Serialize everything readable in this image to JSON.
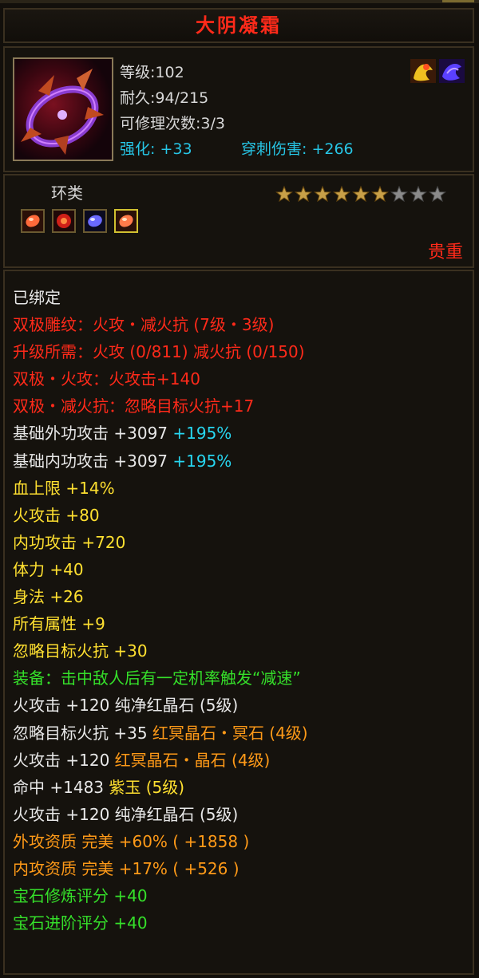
{
  "title": "大阴凝霜",
  "item": {
    "level": "等级:102",
    "durability": "耐久:94/215",
    "repairs": "可修理次数:3/3",
    "enhance": "强化: +33",
    "pierce": "穿刺伤害: +266"
  },
  "category": "环类",
  "stars": {
    "filled": 6,
    "total": 9
  },
  "rarity": "贵重",
  "colors": {
    "title": "#ff2a1a",
    "cyan": "#27d6f0",
    "green": "#35e02a",
    "orange": "#ff9a18",
    "yellow": "#ffe030",
    "red": "#ff2a1a",
    "white": "#e8e8e8"
  },
  "lines": [
    {
      "segs": [
        {
          "t": "已绑定",
          "c": "white"
        }
      ]
    },
    {
      "segs": [
        {
          "t": "双极雕纹：火攻・减火抗 (7级・3级)",
          "c": "red"
        }
      ]
    },
    {
      "segs": [
        {
          "t": "升级所需：火攻 (0/811)  减火抗 (0/150)",
          "c": "red"
        }
      ]
    },
    {
      "segs": [
        {
          "t": "双极・火攻：火攻击+140",
          "c": "red"
        }
      ]
    },
    {
      "segs": [
        {
          "t": "双极・减火抗：忽略目标火抗+17",
          "c": "red"
        }
      ]
    },
    {
      "segs": [
        {
          "t": "基础外功攻击 +3097 ",
          "c": "white"
        },
        {
          "t": "+195%",
          "c": "cyan"
        }
      ]
    },
    {
      "segs": [
        {
          "t": "基础内功攻击 +3097 ",
          "c": "white"
        },
        {
          "t": "+195%",
          "c": "cyan"
        }
      ]
    },
    {
      "segs": [
        {
          "t": "血上限 ",
          "c": "yellow"
        },
        {
          "t": "+14%",
          "c": "yellow"
        }
      ]
    },
    {
      "segs": [
        {
          "t": "火攻击 +80",
          "c": "yellow"
        }
      ]
    },
    {
      "segs": [
        {
          "t": "内功攻击 +720",
          "c": "yellow"
        }
      ]
    },
    {
      "segs": [
        {
          "t": "体力 +40",
          "c": "yellow"
        }
      ]
    },
    {
      "segs": [
        {
          "t": "身法 +26",
          "c": "yellow"
        }
      ]
    },
    {
      "segs": [
        {
          "t": "所有属性 +9",
          "c": "yellow"
        }
      ]
    },
    {
      "segs": [
        {
          "t": "忽略目标火抗 +30",
          "c": "yellow"
        }
      ]
    },
    {
      "segs": [
        {
          "t": "装备：击中敌人后有一定机率触发“减速”",
          "c": "green"
        }
      ]
    },
    {
      "segs": [
        {
          "t": "火攻击 +120 纯净红晶石 (5级)",
          "c": "white"
        }
      ]
    },
    {
      "segs": [
        {
          "t": "忽略目标火抗 +35 ",
          "c": "white"
        },
        {
          "t": "红冥晶石・冥石 (4级)",
          "c": "orange"
        }
      ]
    },
    {
      "segs": [
        {
          "t": "火攻击 +120 ",
          "c": "white"
        },
        {
          "t": "红冥晶石・晶石 (4级)",
          "c": "orange"
        }
      ]
    },
    {
      "segs": [
        {
          "t": "命中 +1483 ",
          "c": "white"
        },
        {
          "t": "紫玉 (5级)",
          "c": "yellow"
        }
      ]
    },
    {
      "segs": [
        {
          "t": "火攻击 +120 纯净红晶石 (5级)",
          "c": "white"
        }
      ]
    },
    {
      "segs": [
        {
          "t": "外攻资质  完美 +60% ( +1858 )",
          "c": "orange"
        }
      ]
    },
    {
      "segs": [
        {
          "t": "内攻资质  完美 +17% ( +526 )",
          "c": "orange"
        }
      ]
    },
    {
      "segs": [
        {
          "t": "宝石修炼评分 +40",
          "c": "green"
        }
      ]
    },
    {
      "segs": [
        {
          "t": "宝石进阶评分 +40",
          "c": "green"
        }
      ]
    }
  ]
}
